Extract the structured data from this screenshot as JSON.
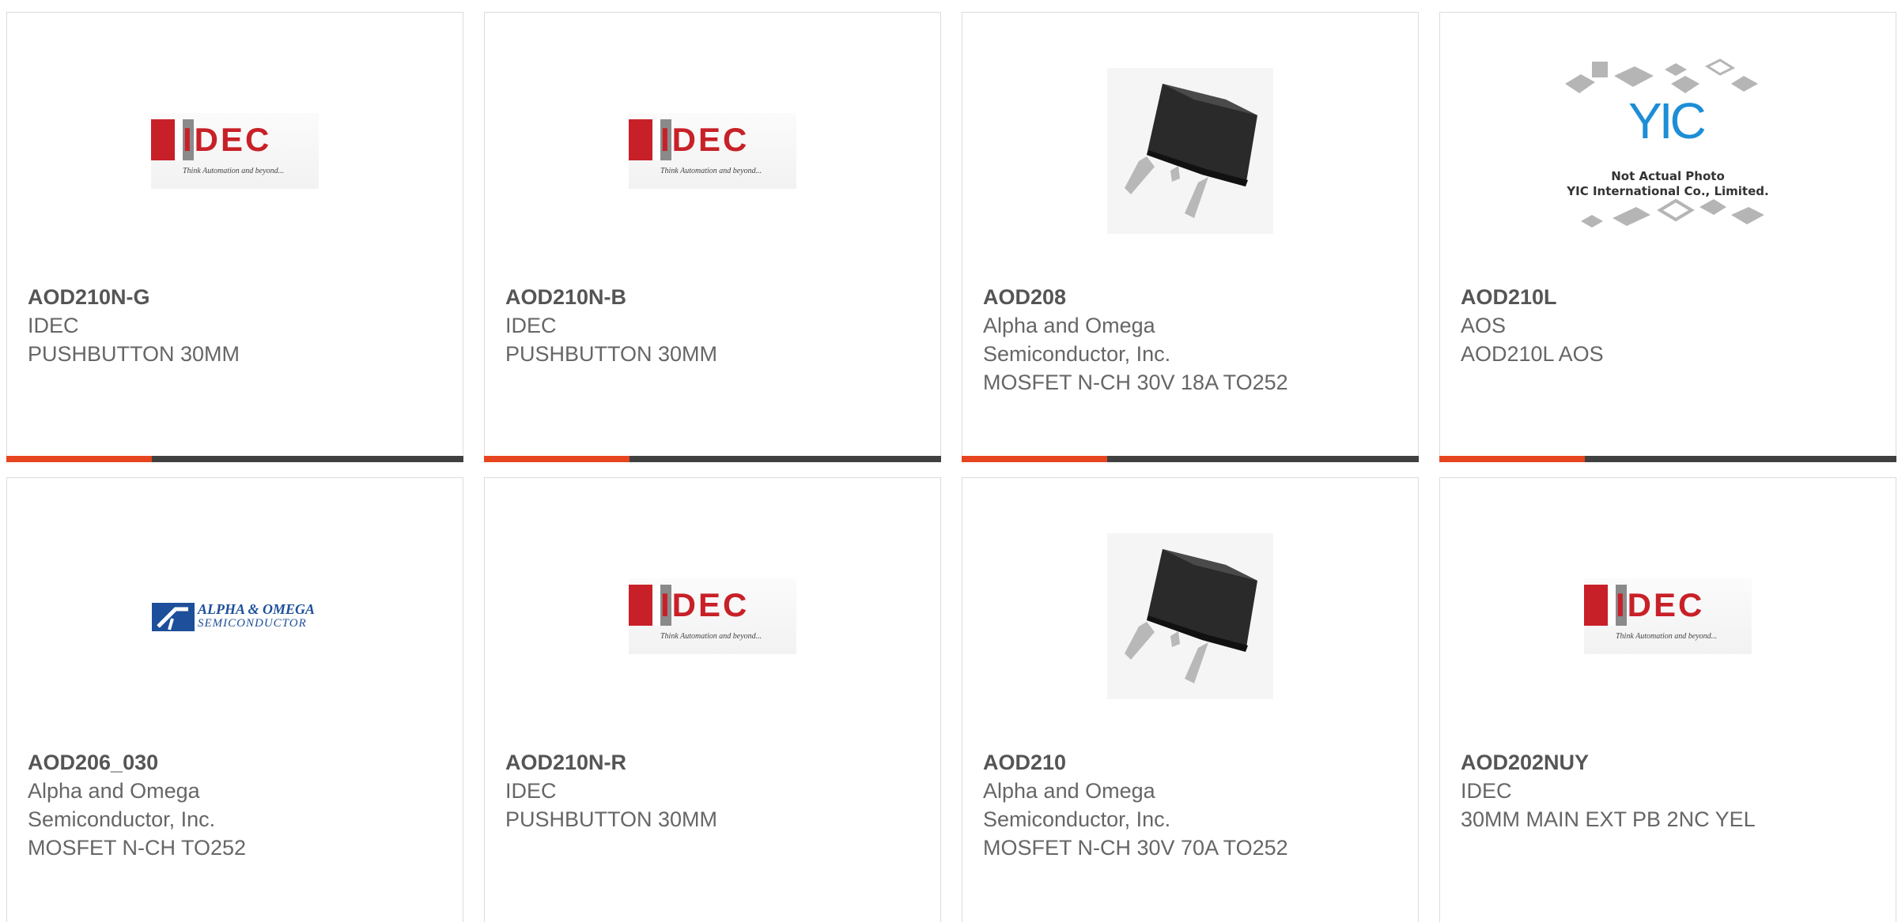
{
  "accent_color": "#e6451f",
  "bar_color": "#404040",
  "products": [
    {
      "part": "AOD210N-G",
      "lines": [
        "IDEC",
        "PUSHBUTTON 30MM"
      ],
      "image": "idec-logo"
    },
    {
      "part": "AOD210N-B",
      "lines": [
        "IDEC",
        "PUSHBUTTON 30MM"
      ],
      "image": "idec-logo"
    },
    {
      "part": "AOD208",
      "lines": [
        "Alpha and Omega",
        "Semiconductor, Inc.",
        "MOSFET N-CH 30V 18A TO252"
      ],
      "image": "to252-chip"
    },
    {
      "part": "AOD210L",
      "lines": [
        "AOS",
        "AOD210L AOS"
      ],
      "image": "yic-not-actual-photo"
    },
    {
      "part": "AOD206_030",
      "lines": [
        "Alpha and Omega",
        "Semiconductor, Inc.",
        "MOSFET N-CH TO252"
      ],
      "image": "alpha-omega-logo"
    },
    {
      "part": "AOD210N-R",
      "lines": [
        "IDEC",
        "PUSHBUTTON 30MM"
      ],
      "image": "idec-logo"
    },
    {
      "part": "AOD210",
      "lines": [
        "Alpha and Omega",
        "Semiconductor, Inc.",
        "MOSFET N-CH 30V 70A TO252"
      ],
      "image": "to252-chip"
    },
    {
      "part": "AOD202NUY",
      "lines": [
        "IDEC",
        "30MM MAIN EXT PB 2NC YEL"
      ],
      "image": "idec-logo"
    }
  ],
  "logos": {
    "idec_text": "IDEC",
    "idec_tagline": "Think Automation and beyond...",
    "yic_mark": "YIC",
    "yic_caption_1": "Not Actual Photo",
    "yic_caption_2": "YIC International Co., Limited.",
    "aos_line_1": "ALPHA & OMEGA",
    "aos_line_2": "SEMICONDUCTOR"
  }
}
